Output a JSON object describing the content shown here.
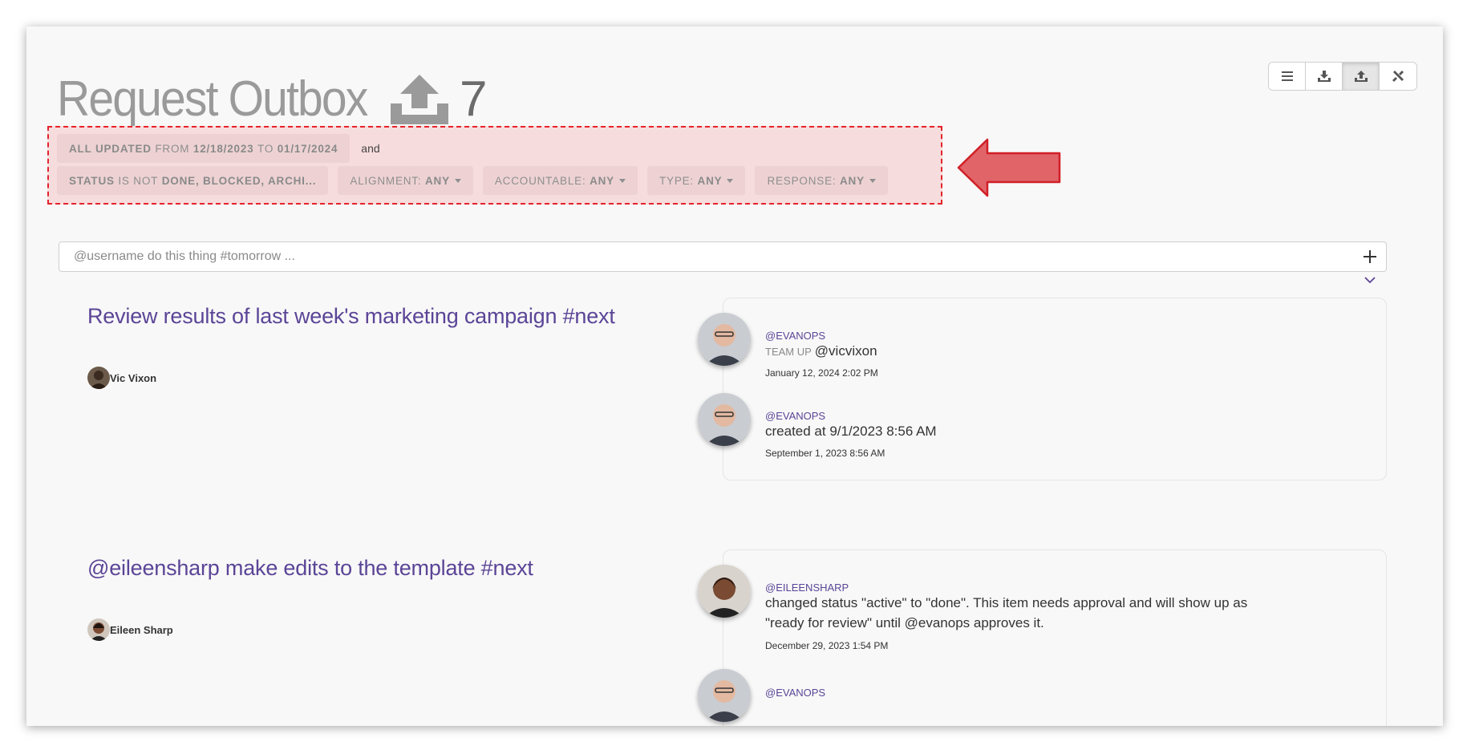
{
  "header": {
    "title": "Request Outbox",
    "count": "7"
  },
  "toolbar": {
    "icons": [
      "list-icon",
      "inbox-icon",
      "outbox-icon",
      "tools-icon"
    ],
    "active": "outbox"
  },
  "filters": {
    "updated": {
      "prefix": "ALL UPDATED",
      "from_word": "FROM",
      "from": "12/18/2023",
      "to_word": "TO",
      "to": "01/17/2024"
    },
    "joiner": "and",
    "status": {
      "prefix": "STATUS",
      "op": "IS NOT",
      "value": "DONE, BLOCKED, ARCHI..."
    },
    "alignment": {
      "label": "ALIGNMENT:",
      "value": "ANY"
    },
    "accountable": {
      "label": "ACCOUNTABLE:",
      "value": "ANY"
    },
    "type": {
      "label": "TYPE:",
      "value": "ANY"
    },
    "response": {
      "label": "RESPONSE:",
      "value": "ANY"
    }
  },
  "composer": {
    "placeholder": "@username do this thing #tomorrow ..."
  },
  "tasks": [
    {
      "title": "Review results of last week's marketing campaign #next",
      "assignee": "Vic Vixon",
      "activity": [
        {
          "user": "@EVANOPS",
          "action_label": "TEAM UP",
          "text": "@vicvixon",
          "time": "January 12, 2024 2:02 PM"
        },
        {
          "user": "@EVANOPS",
          "action_label": "",
          "text": "created at 9/1/2023 8:56 AM",
          "time": "September 1, 2023 8:56 AM"
        }
      ]
    },
    {
      "title": "@eileensharp make edits to the template #next",
      "assignee": "Eileen Sharp",
      "activity": [
        {
          "user": "@EILEENSHARP",
          "action_label": "",
          "text_line1": "changed status \"active\" to \"done\". This item needs approval and will show up as",
          "text_line2": "\"ready for review\" until @evanops approves it.",
          "time": "December 29, 2023 1:54 PM"
        },
        {
          "user": "@EVANOPS"
        }
      ]
    }
  ],
  "colors": {
    "accent": "#5b4597",
    "highlight_border": "#e3242b",
    "highlight_fill": "#f7dcdd",
    "arrow": "#e06468"
  }
}
